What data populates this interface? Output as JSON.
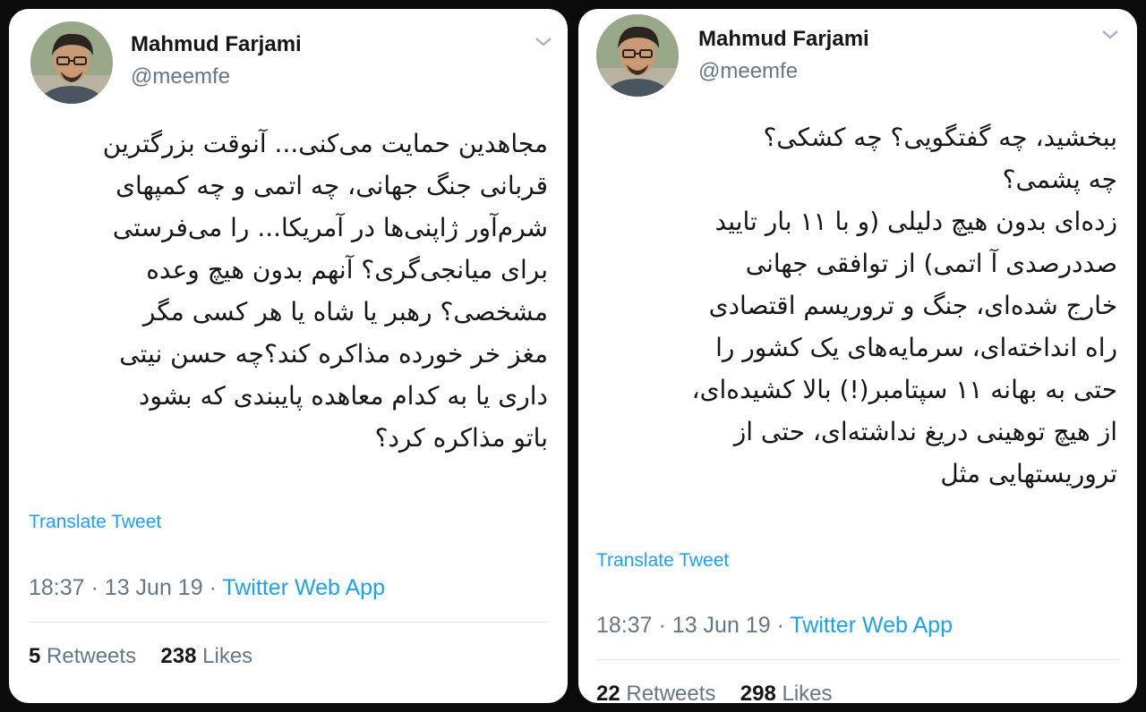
{
  "tweets": [
    {
      "author_name": "Mahmud Farjami",
      "handle": "@meemfe",
      "lines": [
        "مجاهدین حمایت می‌کنی... آنوقت بزرگترین",
        "قربانی جنگ جهانی، چه اتمی و چه کمپهای",
        "شرم‌آور ژاپنی‌ها در آمریکا... را می‌فرستی",
        "برای میانجی‌گری؟ آنهم بدون هیچ وعده",
        "مشخصی؟ رهبر یا شاه یا هر کسی مگر",
        "مغز خر خورده مذاکره کند؟چه حسن نیتی",
        "داری یا به کدام معاهده پایبندی که بشود",
        "باتو مذاکره کرد؟"
      ],
      "translate_label": "Translate Tweet",
      "time": "18:37",
      "date": "13 Jun 19",
      "separator": "·",
      "source": "Twitter Web App",
      "retweets_count": "5",
      "retweets_label": "Retweets",
      "likes_count": "238",
      "likes_label": "Likes"
    },
    {
      "author_name": "Mahmud Farjami",
      "handle": "@meemfe",
      "lines": [
        "ببخشید، چه گفتگویی؟ چه کشکی؟",
        "چه پشمی؟",
        "زده‌ای بدون هیچ دلیلی (و با ۱۱ بار تایید",
        "صددرصدی آ اتمی) از توافقی جهانی",
        "خارج شده‌ای، جنگ و تروریسم اقتصادی",
        "راه انداخته‌ای، سرمایه‌های یک کشور را",
        "حتی به بهانه ۱۱ سپتامبر(!) بالا کشیده‌ای،",
        "از هیچ توهینی دریغ نداشته‌ای، حتی از",
        "تروریستهایی مثل"
      ],
      "translate_label": "Translate Tweet",
      "time": "18:37",
      "date": "13 Jun 19",
      "separator": "·",
      "source": "Twitter Web App",
      "retweets_count": "22",
      "retweets_label": "Retweets",
      "likes_count": "298",
      "likes_label": "Likes"
    }
  ],
  "icons": {
    "avatar": "profile-photo",
    "menu": "chevron-down-icon"
  },
  "colors": {
    "link": "#1da1f2",
    "muted": "#657786",
    "text": "#14171a",
    "frame": "#0b0b0b"
  }
}
